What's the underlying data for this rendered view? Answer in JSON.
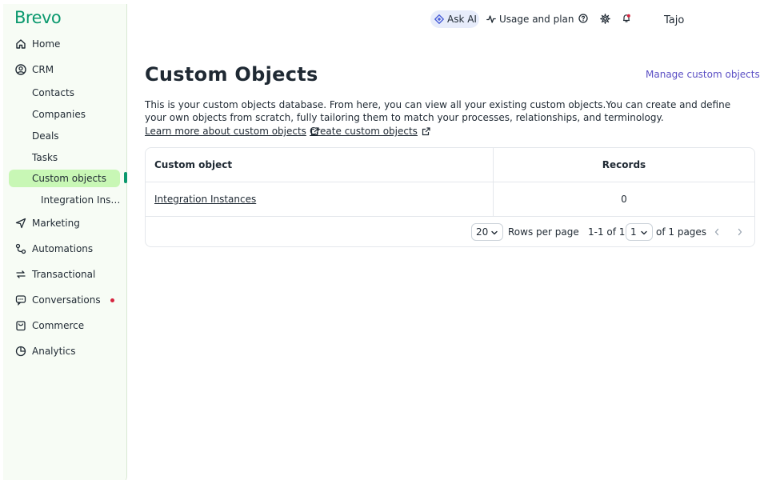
{
  "brand": {
    "logo_text": "Brevo",
    "color": "#0b996e"
  },
  "sidebar": {
    "items": [
      {
        "label": "Home",
        "icon": "home-icon"
      },
      {
        "label": "CRM",
        "icon": "user-circle-icon"
      },
      {
        "label": "Marketing",
        "icon": "send-icon"
      },
      {
        "label": "Automations",
        "icon": "automation-icon"
      },
      {
        "label": "Transactional",
        "icon": "repeat-icon"
      },
      {
        "label": "Conversations",
        "icon": "chat-icon"
      },
      {
        "label": "Commerce",
        "icon": "shopping-bag-icon"
      },
      {
        "label": "Analytics",
        "icon": "pie-chart-icon"
      }
    ],
    "crm_subitems": [
      "Contacts",
      "Companies",
      "Deals",
      "Tasks",
      "Custom objects"
    ],
    "custom_object_child": "Integration Instances",
    "active_color": "#c8f7b5",
    "notification_color": "#d6243f"
  },
  "topbar": {
    "ask_ai": "Ask AI",
    "usage": "Usage and plan",
    "username": "Tajo",
    "icons": [
      "help-icon",
      "settings-icon",
      "bell-icon"
    ]
  },
  "main": {
    "title": "Custom Objects",
    "manage_link": "Manage custom objects",
    "description": "This is your custom objects database. From here, you can view all your existing custom objects.You can create and define your own objects from scratch, fully tailoring them to match your processes, relationships, and terminology.",
    "learn_link": "Learn more about custom objects",
    "create_link": "Create custom objects",
    "link_color": "#5b4fc4"
  },
  "table": {
    "columns": [
      "Custom object",
      "Records"
    ],
    "rows": [
      {
        "name": "Integration Instances",
        "records": "0"
      }
    ],
    "pagination": {
      "rows_per_page_value": "20",
      "rows_per_page_label": "Rows per page",
      "range": "1-1 of 1",
      "page_value": "1",
      "pages_label": "of 1 pages"
    }
  }
}
